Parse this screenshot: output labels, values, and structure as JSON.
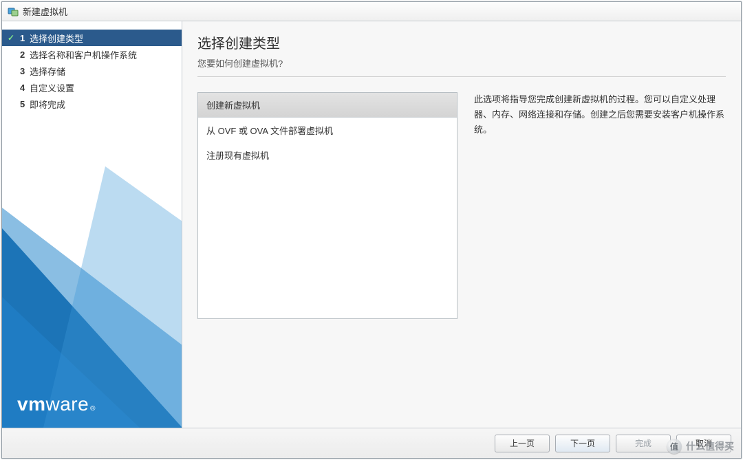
{
  "window": {
    "title": "新建虚拟机"
  },
  "sidebar": {
    "steps": [
      {
        "num": "1",
        "label": "选择创建类型",
        "active": true
      },
      {
        "num": "2",
        "label": "选择名称和客户机操作系统"
      },
      {
        "num": "3",
        "label": "选择存储"
      },
      {
        "num": "4",
        "label": "自定义设置"
      },
      {
        "num": "5",
        "label": "即将完成"
      }
    ],
    "logo": {
      "vm": "vm",
      "ware": "ware",
      "reg": "®"
    }
  },
  "main": {
    "heading": "选择创建类型",
    "subtitle": "您要如何创建虚拟机?",
    "options": [
      {
        "label": "创建新虚拟机",
        "selected": true
      },
      {
        "label": "从 OVF 或 OVA 文件部署虚拟机"
      },
      {
        "label": "注册现有虚拟机"
      }
    ],
    "description": "此选项将指导您完成创建新虚拟机的过程。您可以自定义处理器、内存、网络连接和存储。创建之后您需要安装客户机操作系统。"
  },
  "footer": {
    "back": "上一页",
    "next": "下一页",
    "finish": "完成",
    "cancel": "取消"
  },
  "watermark": {
    "badge": "值",
    "text": "什么值得买"
  }
}
